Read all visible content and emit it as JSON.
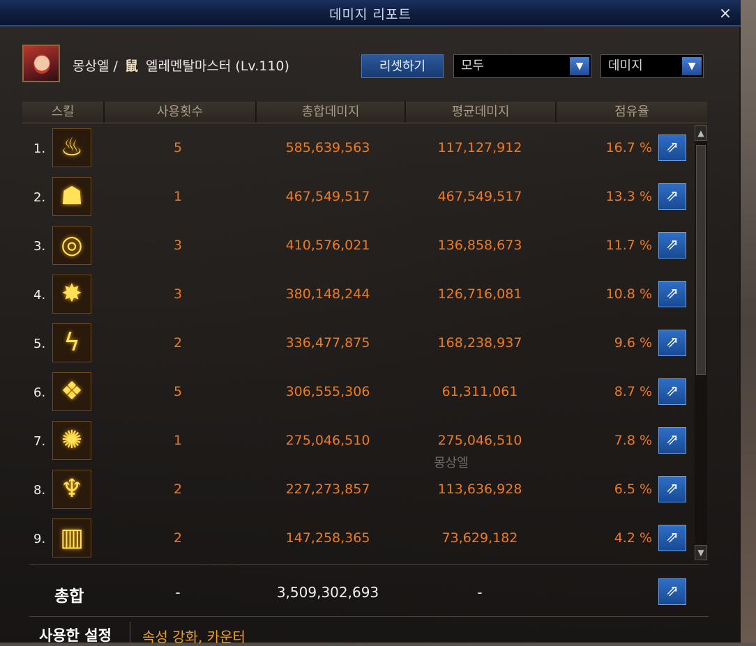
{
  "window": {
    "title": "데미지 리포트",
    "close_label": "×"
  },
  "character": {
    "name": "몽상엘",
    "separator": "/",
    "job_icon": "鼠",
    "job": "엘레멘탈마스터",
    "level": "(Lv.110)"
  },
  "controls": {
    "reset_label": "리셋하기",
    "filter1_value": "모두",
    "filter2_value": "데미지"
  },
  "table": {
    "columns": [
      "스킬",
      "사용횟수",
      "총합데미지",
      "평균데미지",
      "점유율"
    ],
    "rows": [
      {
        "rank": "1.",
        "icon": "flame-icon",
        "glyph": "♨",
        "count": "5",
        "total": "585,639,563",
        "average": "117,127,912",
        "share": "16.7 %"
      },
      {
        "rank": "2.",
        "icon": "hood-icon",
        "glyph": "☗",
        "count": "1",
        "total": "467,549,517",
        "average": "467,549,517",
        "share": "13.3 %"
      },
      {
        "rank": "3.",
        "icon": "vortex-icon",
        "glyph": "◎",
        "count": "3",
        "total": "410,576,021",
        "average": "136,858,673",
        "share": "11.7 %"
      },
      {
        "rank": "4.",
        "icon": "burst-icon",
        "glyph": "✸",
        "count": "3",
        "total": "380,148,244",
        "average": "126,716,081",
        "share": "10.8 %"
      },
      {
        "rank": "5.",
        "icon": "lightning-icon",
        "glyph": "ϟ",
        "count": "2",
        "total": "336,477,875",
        "average": "168,238,937",
        "share": "9.6 %"
      },
      {
        "rank": "6.",
        "icon": "crystal-icon",
        "glyph": "❖",
        "count": "5",
        "total": "306,555,306",
        "average": "61,311,061",
        "share": "8.7 %"
      },
      {
        "rank": "7.",
        "icon": "explosion-icon",
        "glyph": "✺",
        "count": "1",
        "total": "275,046,510",
        "average": "275,046,510",
        "share": "7.8 %"
      },
      {
        "rank": "8.",
        "icon": "fire-ring-icon",
        "glyph": "♆",
        "count": "2",
        "total": "227,273,857",
        "average": "113,636,928",
        "share": "6.5 %"
      },
      {
        "rank": "9.",
        "icon": "pillar-icon",
        "glyph": "▥",
        "count": "2",
        "total": "147,258,365",
        "average": "73,629,182",
        "share": "4.2 %"
      }
    ]
  },
  "total": {
    "label": "총합",
    "count": "-",
    "sum": "3,509,302,693",
    "average": "-"
  },
  "settings": {
    "label": "사용한 설정",
    "value": "속성 강화, 카운터"
  },
  "background": {
    "character_name": "몽상엘"
  },
  "colors": {
    "accent": "#f07a1e",
    "title_bar": "#0f1d3e",
    "button": "#2f6fc6"
  }
}
